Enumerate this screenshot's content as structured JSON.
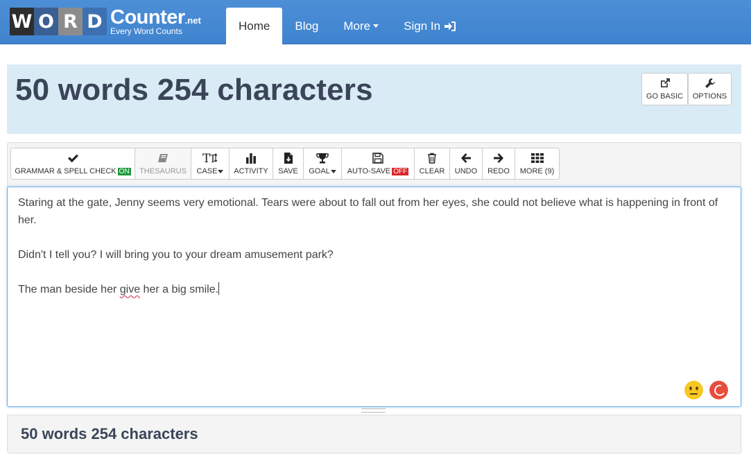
{
  "logo": {
    "letters": [
      "W",
      "O",
      "R",
      "D"
    ],
    "brand": "Counter",
    "tld": ".net",
    "tagline": "Every Word Counts"
  },
  "nav": {
    "home": "Home",
    "blog": "Blog",
    "more": "More",
    "sign_in": "Sign In"
  },
  "header": {
    "count_text": "50 words 254 characters",
    "go_basic_label": "GO BASIC",
    "options_label": "OPTIONS"
  },
  "toolbar": {
    "grammar_label": "GRAMMAR & SPELL CHECK",
    "grammar_status": "ON",
    "thesaurus_label": "THESAURUS",
    "case_label": "CASE",
    "activity_label": "ACTIVITY",
    "save_label": "SAVE",
    "goal_label": "GOAL",
    "autosave_label": "AUTO-SAVE",
    "autosave_status": "OFF",
    "clear_label": "CLEAR",
    "undo_label": "UNDO",
    "redo_label": "REDO",
    "more_label": "MORE (9)"
  },
  "editor": {
    "para1": "Staring at the gate, Jenny seems very emotional. Tears were about to fall out from her eyes, she could not believe what is happening in front of her.",
    "para2": "Didn't I tell you? I will bring you to your dream amusement park?",
    "para3_before": "The man beside her ",
    "para3_flagged": "give",
    "para3_after": " her a big smile."
  },
  "footer": {
    "count_text": "50 words 254 characters"
  },
  "colors": {
    "navbar": "#4a90d9",
    "header_band": "#d9ebf5",
    "status_on": "#1e9b3a",
    "status_off": "#d9262a",
    "count_text": "#3a4558"
  },
  "icons": {
    "go_basic": "external-link-icon",
    "options": "wrench-icon",
    "grammar": "check-icon",
    "thesaurus": "book-icon",
    "case": "text-size-icon",
    "activity": "bar-chart-icon",
    "save": "save-file-icon",
    "goal": "trophy-icon",
    "autosave": "floppy-icon",
    "clear": "trash-icon",
    "undo": "arrow-left-icon",
    "redo": "arrow-right-icon",
    "more": "grid-icon",
    "sign_in": "sign-in-icon",
    "mood": "neutral-face-icon",
    "spinner": "loading-spinner-icon"
  }
}
